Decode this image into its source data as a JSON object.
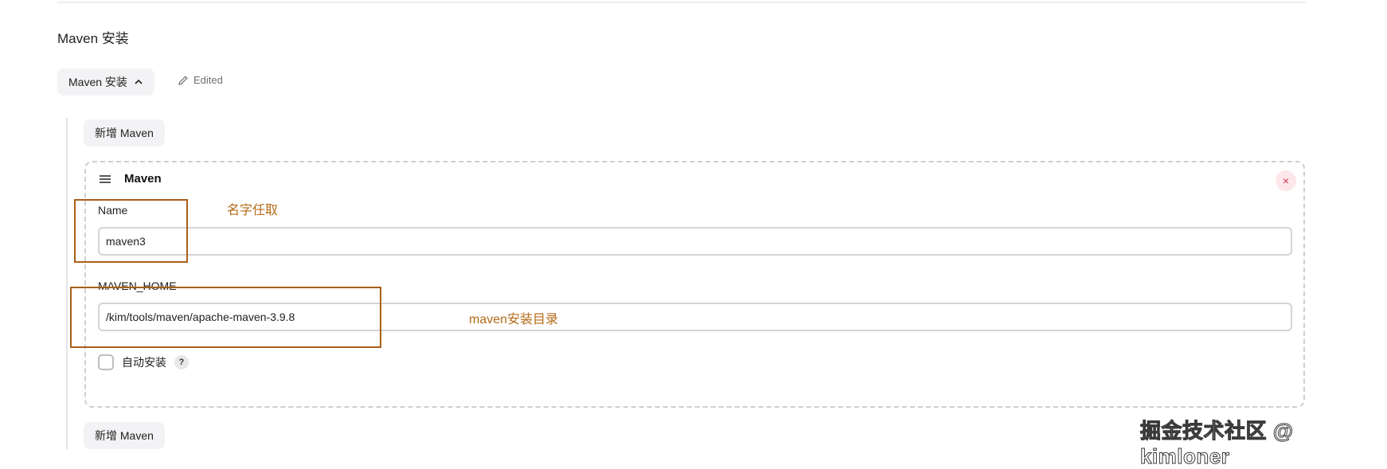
{
  "section": {
    "title": "Maven 安装",
    "collapse_button_label": "Maven 安装",
    "edited_label": "Edited"
  },
  "add_button_label": "新增 Maven",
  "maven_entry": {
    "header": "Maven",
    "delete_symbol": "×",
    "name_label": "Name",
    "name_value": "maven3",
    "home_label": "MAVEN_HOME",
    "home_value": "/kim/tools/maven/apache-maven-3.9.8",
    "auto_install_label": "自动安装",
    "help_symbol": "?"
  },
  "annotations": {
    "name_note": "名字任取",
    "home_note": "maven安装目录"
  },
  "watermark": "掘金技术社区 @ kimloner",
  "colors": {
    "annotation": "#a95f19",
    "delete_accent": "#d4344b",
    "dashed_border": "#cfcfd4"
  },
  "icons": [
    "chevron-up-icon",
    "pencil-icon",
    "drag-handle-icon",
    "close-icon",
    "help-icon"
  ]
}
